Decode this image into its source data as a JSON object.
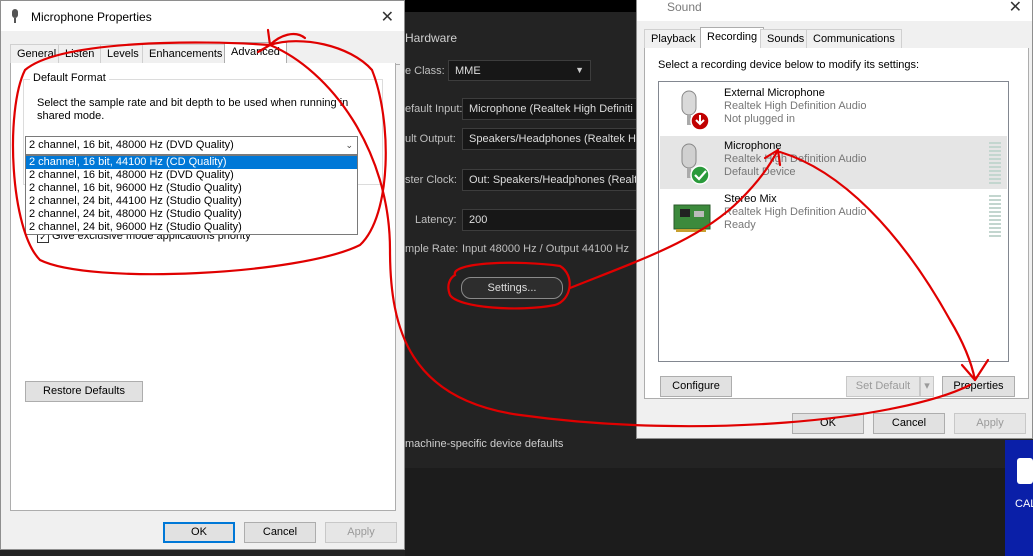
{
  "background_app": {
    "section_title": "Hardware",
    "labels": {
      "device_class": "e Class:",
      "default_input": "efault Input:",
      "default_output": "ult Output:",
      "master_clock": "ster Clock:",
      "latency": "Latency:",
      "sample_rate": "mple Rate:"
    },
    "device_class_value": "MME",
    "default_input_value": "Microphone (Realtek High Definiti",
    "default_output_value": "Speakers/Headphones (Realtek Hig",
    "master_clock_value": "Out: Speakers/Headphones (Realte",
    "latency_value": "200",
    "sample_rate_value": "Input 48000 Hz / Output 44100 Hz",
    "settings_button": "Settings...",
    "footer_text": "machine-specific device defaults",
    "desktop_icon_label": "CAL"
  },
  "mic_props": {
    "title": "Microphone Properties",
    "tabs": [
      {
        "label": "General"
      },
      {
        "label": "Listen"
      },
      {
        "label": "Levels"
      },
      {
        "label": "Enhancements"
      },
      {
        "label": "Advanced"
      }
    ],
    "default_format_title": "Default Format",
    "description": "Select the sample rate and bit depth to be used when running in shared mode.",
    "selected_format": "2 channel, 16 bit, 48000 Hz (DVD Quality)",
    "format_options": [
      "2 channel, 16 bit, 44100 Hz (CD Quality)",
      "2 channel, 16 bit, 48000 Hz (DVD Quality)",
      "2 channel, 16 bit, 96000 Hz (Studio Quality)",
      "2 channel, 24 bit, 44100 Hz (Studio Quality)",
      "2 channel, 24 bit, 48000 Hz (Studio Quality)",
      "2 channel, 24 bit, 96000 Hz (Studio Quality)"
    ],
    "highlighted_index": 0,
    "group2_letter": "E",
    "exclusive_priority": "Give exclusive mode applications priority",
    "restore_defaults": "Restore Defaults",
    "ok": "OK",
    "cancel": "Cancel",
    "apply": "Apply"
  },
  "sound": {
    "title": "Sound",
    "tabs": [
      {
        "label": "Playback"
      },
      {
        "label": "Recording"
      },
      {
        "label": "Sounds"
      },
      {
        "label": "Communications"
      }
    ],
    "instruction": "Select a recording device below to modify its settings:",
    "devices": [
      {
        "name": "External Microphone",
        "driver": "Realtek High Definition Audio",
        "status": "Not plugged in",
        "icon": "microphone-unplugged-icon"
      },
      {
        "name": "Microphone",
        "driver": "Realtek High Definition Audio",
        "status": "Default Device",
        "icon": "microphone-default-icon"
      },
      {
        "name": "Stereo Mix",
        "driver": "Realtek High Definition Audio",
        "status": "Ready",
        "icon": "sound-card-icon"
      }
    ],
    "configure": "Configure",
    "set_default": "Set Default",
    "properties": "Properties",
    "ok": "OK",
    "cancel": "Cancel",
    "apply": "Apply"
  }
}
